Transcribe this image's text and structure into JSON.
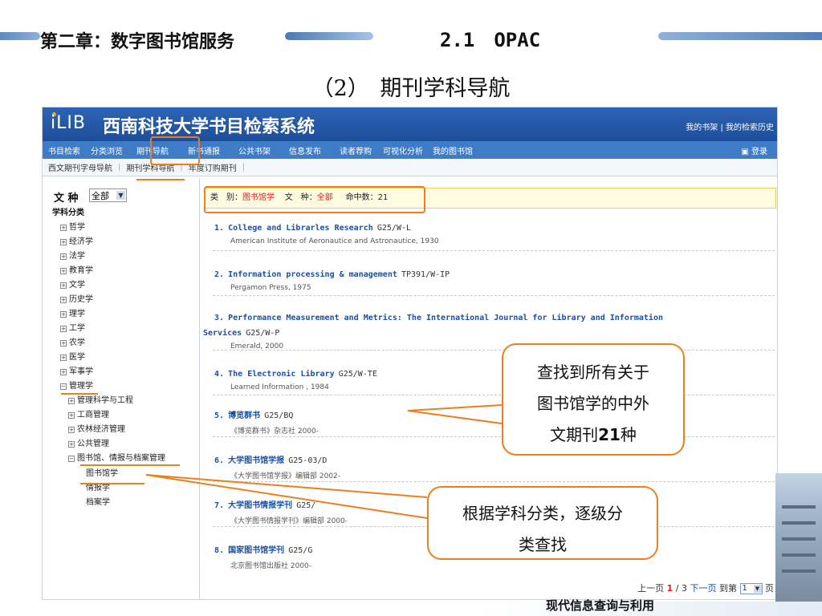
{
  "slide": {
    "chapter_title": "第二章：数字图书馆服务",
    "section_title": "2.1　OPAC",
    "subtitle": "（2）　期刊学科导航",
    "footer": "现代信息查询与利用"
  },
  "app": {
    "logo": "iLIB",
    "title": "西南科技大学书目检索系统",
    "top_links": [
      "我的书架",
      "我的检索历史"
    ],
    "top_links_sep": "|",
    "nav": [
      "书目检索",
      "分类浏览",
      "期刊导航",
      "新书通报",
      "公共书架",
      "信息发布",
      "读者荐购",
      "可视化分析",
      "我的图书馆"
    ],
    "login": "登录",
    "subnav": [
      "西文期刊字母导航",
      "期刊学科导航",
      "年度订购期刊"
    ],
    "subnav_sep": "|"
  },
  "sidebar": {
    "lang_label": "文 种",
    "lang_value": "全部",
    "category_head": "学科分类",
    "items": [
      "哲学",
      "经济学",
      "法学",
      "教育学",
      "文学",
      "历史学",
      "理学",
      "工学",
      "农学",
      "医学",
      "军事学",
      "管理学"
    ],
    "management_children": [
      "管理科学与工程",
      "工商管理",
      "农林经济管理",
      "公共管理",
      "图书馆、情报与档案管理"
    ],
    "library_children": [
      "图书馆学",
      "情报学",
      "档案学"
    ]
  },
  "filter": {
    "type_label": "类　别：",
    "type_value": "图书馆学",
    "lang_label": "文　种：",
    "lang_value": "全部",
    "hits_label": "命中数：",
    "hits_value": "21"
  },
  "results": [
    {
      "num": "1.",
      "title": "College and Librarles Research",
      "call": "G25/W-L",
      "pub": "American Institute of Aeronautice and Astronautice, 1930"
    },
    {
      "num": "2.",
      "title": "Information processing & management",
      "call": "TP391/W-IP",
      "pub": "Pergamon Press, 1975"
    },
    {
      "num": "3.",
      "title": "Performance Measurement and Metrics: The International Journal for Library and Information",
      "title_cont": "Services",
      "call": "G25/W-P",
      "pub": "Emerald, 2000"
    },
    {
      "num": "4.",
      "title": "The Electronic Library",
      "call": "G25/W-TE",
      "pub": "Learned Information , 1984"
    },
    {
      "num": "5.",
      "title": "博览群书",
      "call": "G25/BQ",
      "pub": "《博览群书》杂志社 2000-"
    },
    {
      "num": "6.",
      "title": "大学图书馆学报",
      "call": "G25-03/D",
      "pub": "《大学图书馆学报》编辑部 2002-"
    },
    {
      "num": "7.",
      "title": "大学图书情报学刊",
      "call": "G25/",
      "pub": "《大学图书情报学刊》编辑部 2000-"
    },
    {
      "num": "8.",
      "title": "国家图书馆学刊",
      "call": "G25/G",
      "pub": "北京图书馆出版社 2000-"
    }
  ],
  "pager": {
    "prev": "上一页",
    "current": "1",
    "total": "/ 3",
    "next": "下一页",
    "goto": "到第",
    "page_value": "1",
    "page_suffix": "页"
  },
  "callouts": {
    "found_line1": "查找到所有关于",
    "found_line2": "图书馆学的中外",
    "found_line3_a": "文期刊",
    "found_line3_b": "21",
    "found_line3_c": "种",
    "subject_line1": "根据学科分类，逐级分",
    "subject_line2": "类查找"
  },
  "colors": {
    "accent": "#ee7d1c",
    "brand_blue": "#2d64b4",
    "nav_blue": "#3f7cc8",
    "link_blue": "#1b4fa0",
    "highlight_red": "#e02020"
  }
}
